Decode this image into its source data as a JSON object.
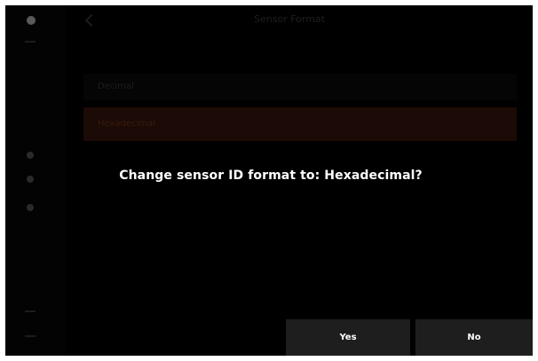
{
  "background": {
    "header_title": "Sensor Format",
    "rows": [
      "Decimal",
      "Hexadecimal"
    ]
  },
  "dialog": {
    "message": "Change sensor ID format to: Hexadecimal?",
    "yes_label": "Yes",
    "no_label": "No"
  },
  "colors": {
    "screen_bg": "#000000",
    "button_bg": "#1e1e1e",
    "selected_row": "#1b0a05",
    "text": "#ffffff"
  }
}
